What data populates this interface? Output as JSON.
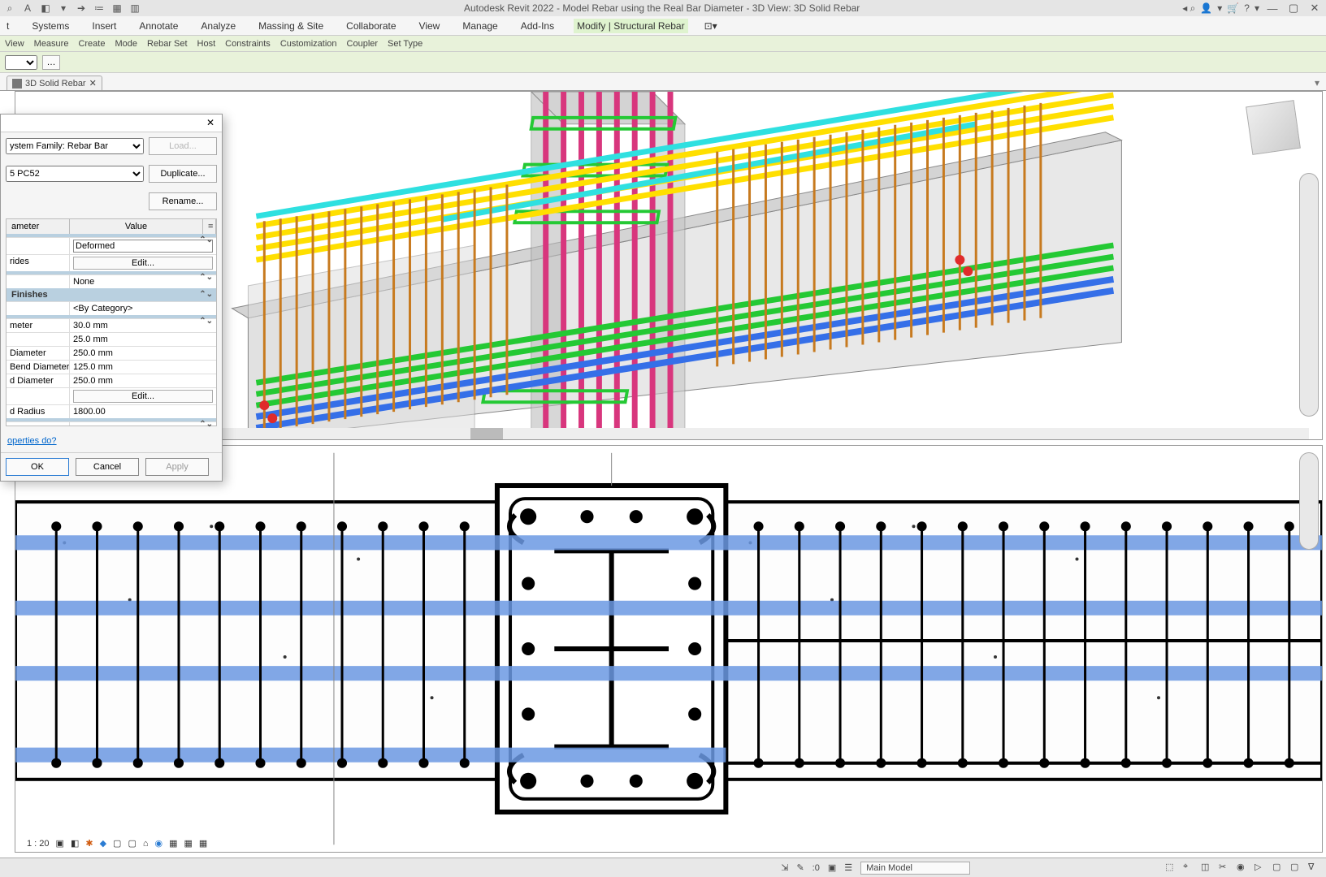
{
  "app": {
    "title": "Autodesk Revit 2022 - Model Rebar using the Real Bar Diameter - 3D View: 3D Solid Rebar"
  },
  "qat_icons": [
    "magnify-icon",
    "letter-a-icon",
    "swatch-icon",
    "dropdown-icon",
    "arrow-icon",
    "indent-icon",
    "grid-icon",
    "grid2-icon"
  ],
  "title_right_icons": [
    "binoculars-icon",
    "user-icon",
    "dropdown-small-icon",
    "cart-icon",
    "help-icon",
    "dropdown2-icon"
  ],
  "menu": {
    "items": [
      "t",
      "Systems",
      "Insert",
      "Annotate",
      "Analyze",
      "Massing & Site",
      "Collaborate",
      "View",
      "Manage",
      "Add-Ins",
      "Modify | Structural Rebar"
    ],
    "active_index": 10,
    "trailing_icon": "settings-dropdown-icon"
  },
  "ribbon_sub": [
    "View",
    "Measure",
    "Create",
    "Mode",
    "Rebar Set",
    "Host",
    "Constraints",
    "Customization",
    "Coupler",
    "Set Type"
  ],
  "doc_tab": {
    "label": "3D Solid Rebar"
  },
  "dialog": {
    "family_label": "ystem Family: Rebar Bar",
    "type_label": "5 PC52",
    "load": "Load...",
    "duplicate": "Duplicate...",
    "rename": "Rename...",
    "col_parameter": "ameter",
    "col_value": "Value",
    "col_eq": "=",
    "rows": [
      {
        "sec": true,
        "label": ""
      },
      {
        "label": "",
        "value": "Deformed",
        "input": true
      },
      {
        "label": "rides",
        "value": "Edit...",
        "button": true
      },
      {
        "sec": true,
        "label": ""
      },
      {
        "label": "",
        "value": "None"
      },
      {
        "sec": true,
        "label": "Finishes"
      },
      {
        "label": "",
        "value": "<By Category>"
      },
      {
        "sec": true,
        "label": ""
      },
      {
        "label": "meter",
        "value": "30.0 mm"
      },
      {
        "label": "",
        "value": "25.0 mm"
      },
      {
        "label": "Diameter",
        "value": "250.0 mm"
      },
      {
        "label": " Bend Diameter",
        "value": "125.0 mm"
      },
      {
        "label": "d Diameter",
        "value": "250.0 mm"
      },
      {
        "label": "",
        "value": "Edit...",
        "button": true
      },
      {
        "label": "d Radius",
        "value": "1800.00"
      },
      {
        "sec": true,
        "label": ""
      },
      {
        "label": "",
        "value": ""
      }
    ],
    "link": "operties do?",
    "ok": "OK",
    "cancel": "Cancel",
    "apply": "Apply"
  },
  "scale": "1 : 20",
  "status": {
    "zero": ":0",
    "main_model": "Main Model"
  },
  "colors": {
    "yellow": "#ffdf00",
    "cyan": "#2fe0e0",
    "magenta": "#d8367d",
    "green": "#24c934",
    "orange": "#c77a1f",
    "blue": "#356fe8",
    "red": "#e02b2b",
    "plan_blue": "#6c99e3"
  }
}
